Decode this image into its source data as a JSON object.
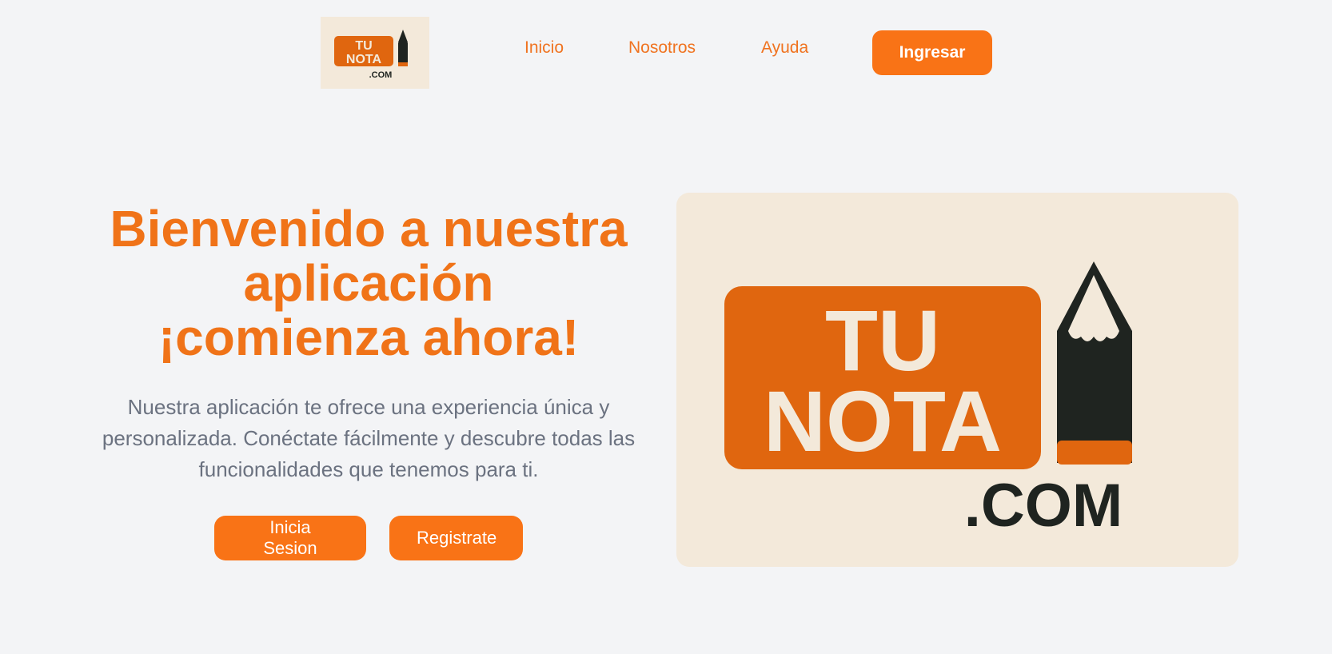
{
  "brand": {
    "logo_line1": "TU",
    "logo_line2": "NOTA",
    "logo_suffix": ".COM"
  },
  "nav": {
    "links": [
      {
        "label": "Inicio"
      },
      {
        "label": "Nosotros"
      },
      {
        "label": "Ayuda"
      }
    ],
    "cta_label": "Ingresar"
  },
  "hero": {
    "title_lines": [
      "Bienvenido a nuestra",
      "aplicación",
      "¡comienza ahora!"
    ],
    "description": "Nuestra aplicación te ofrece una experiencia única y personalizada. Conéctate fácilmente y descubre todas las funcionalidades que tenemos para ti.",
    "buttons": [
      {
        "label": "Inicia Sesion"
      },
      {
        "label": "Registrate"
      }
    ]
  },
  "colors": {
    "accent": "#f97316",
    "logo_orange": "#e0660f",
    "logo_bg": "#f3e9da",
    "pencil_dark": "#1f2420",
    "background": "#f3f4f6",
    "body_text": "#6b7280"
  }
}
